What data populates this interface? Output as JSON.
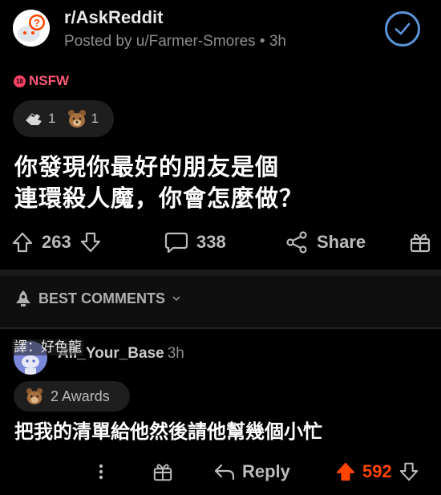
{
  "header": {
    "subreddit": "r/AskReddit",
    "posted_by": "Posted by u/Farmer-Smores • 3h"
  },
  "post": {
    "nsfw_label": "NSFW",
    "nsfw_badge": "18",
    "awards": [
      {
        "icon": "helping-hand-award-icon",
        "count": "1"
      },
      {
        "icon": "bear-award-icon",
        "count": "1"
      }
    ],
    "title_line1": "你發現你最好的朋友是個",
    "title_line2": "連環殺人魔，你會怎麼做？",
    "score": "263",
    "comments_count": "338",
    "share_label": "Share"
  },
  "comments_header": {
    "sort_label": "BEST COMMENTS"
  },
  "comment": {
    "translator_note": "譯：好色龍",
    "author": "All_Your_Base",
    "time": "3h",
    "awards_label": "2 Awards",
    "body": "把我的清單給他然後請他幫幾個小忙",
    "reply_label": "Reply",
    "score": "592"
  },
  "colors": {
    "accent_upvote": "#ff4500",
    "nsfw": "#ff5a77",
    "join_ring": "#5c94d9"
  }
}
